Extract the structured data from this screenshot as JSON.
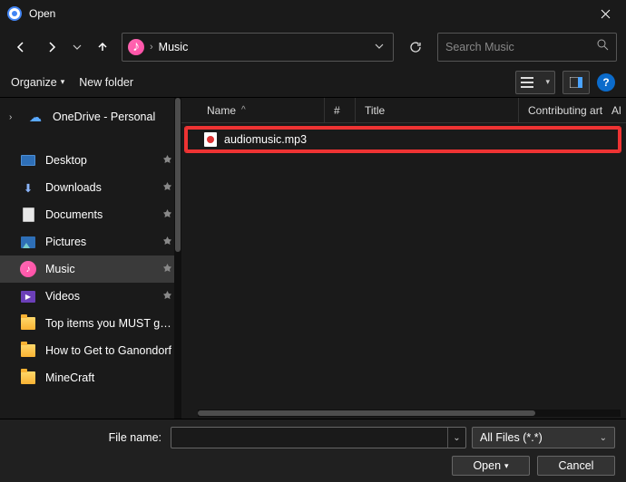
{
  "window": {
    "title": "Open"
  },
  "address": {
    "location": "Music"
  },
  "search": {
    "placeholder": "Search Music"
  },
  "toolbar": {
    "organize": "Organize",
    "new_folder": "New folder"
  },
  "sidebar": {
    "onedrive": "OneDrive - Personal",
    "items": [
      {
        "label": "Desktop",
        "pin": true,
        "icon": "pc"
      },
      {
        "label": "Downloads",
        "pin": true,
        "icon": "dl"
      },
      {
        "label": "Documents",
        "pin": true,
        "icon": "doc"
      },
      {
        "label": "Pictures",
        "pin": true,
        "icon": "pic"
      },
      {
        "label": "Music",
        "pin": true,
        "icon": "music",
        "selected": true
      },
      {
        "label": "Videos",
        "pin": true,
        "icon": "vid"
      },
      {
        "label": "Top items you MUST get to",
        "pin": false,
        "icon": "folder"
      },
      {
        "label": "How to Get to Ganondorf",
        "pin": false,
        "icon": "folder"
      },
      {
        "label": "MineCraft",
        "pin": false,
        "icon": "folder"
      }
    ]
  },
  "columns": {
    "name": "Name",
    "num": "#",
    "title": "Title",
    "contrib": "Contributing artists",
    "last": "Al"
  },
  "files": [
    {
      "name": "audiomusic.mp3"
    }
  ],
  "footer": {
    "filename_label": "File name:",
    "filename_value": "",
    "filter": "All Files (*.*)",
    "open": "Open",
    "cancel": "Cancel"
  }
}
